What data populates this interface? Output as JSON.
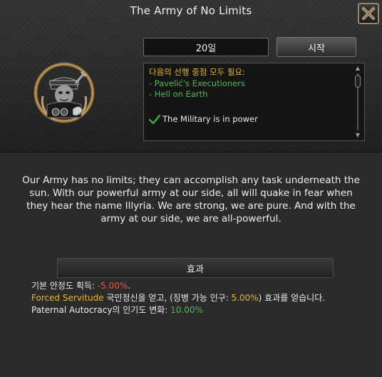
{
  "window": {
    "title": "The Army of No Limits",
    "close_icon": "close-x-icon"
  },
  "emblem": {
    "icon": "military-officer-emblem"
  },
  "controls": {
    "days": "20일",
    "start_label": "시작"
  },
  "requirements": {
    "header": "다음의 선행 중점 모두 필요:",
    "items": [
      "- Pavelić's Executioners",
      "- Hell on Earth"
    ],
    "condition": "The Military is in power"
  },
  "description": "Our Army has no limits; they can accomplish any task underneath the sun. With our powerful army at our side, all will quake in fear when they hear the name Illyria. We are strong, we are pure. And with the army at our side, we are all-powerful.",
  "effects": {
    "header": "효과",
    "line1": {
      "prefix": "기본 안정도 획득: ",
      "value": "-5.00%",
      "suffix": "."
    },
    "line2": {
      "name": "Forced Servitude",
      "text1": " 국민정신을 얻고, (징병 가능 인구: ",
      "value": "5.00%",
      "text2": ") 효과를 얻습니다."
    },
    "line3": {
      "prefix": "Paternal Autocracy의 인기도 변화: ",
      "value": "10.00%"
    }
  },
  "colors": {
    "requirement_header": "#e6b632",
    "requirement_item": "#59b359",
    "negative": "#e0584a",
    "positive": "#59b359",
    "highlight": "#e6b632"
  }
}
